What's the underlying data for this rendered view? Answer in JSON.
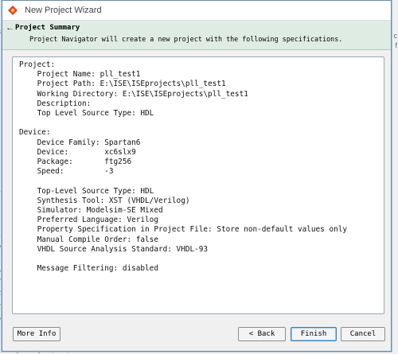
{
  "window": {
    "title": "New Project Wizard"
  },
  "header": {
    "back_glyph": "←",
    "title": "Project Summary",
    "description": "Project Navigator will create a new project with the following specifications."
  },
  "summary": {
    "lines": [
      "Project:",
      "    Project Name: pll_test1",
      "    Project Path: E:\\ISE\\ISEprojects\\pll_test1",
      "    Working Directory: E:\\ISE\\ISEprojects\\pll_test1",
      "    Description:",
      "    Top Level Source Type: HDL",
      "",
      "Device:",
      "    Device Family: Spartan6",
      "    Device:        xc6slx9",
      "    Package:       ftg256",
      "    Speed:         -3",
      "",
      "    Top-Level Source Type: HDL",
      "    Synthesis Tool: XST (VHDL/Verilog)",
      "    Simulator: Modelsim-SE Mixed",
      "    Preferred Language: Verilog",
      "    Property Specification in Project File: Store non-default values only",
      "    Manual Compile Order: false",
      "    VHDL Source Analysis Standard: VHDL-93",
      "",
      "    Message Filtering: disabled"
    ]
  },
  "buttons": {
    "more_info": "More Info",
    "back": "< Back",
    "finish": "Finish",
    "cancel": "Cancel"
  },
  "background": {
    "left_fragments": [
      "8",
      "la",
      "it",
      "d",
      "-",
      "o",
      "T",
      "SS",
      "y",
      "ei"
    ],
    "right_fragments": [
      "c",
      "f"
    ],
    "bottom_text": "sign Using ChipScope"
  }
}
